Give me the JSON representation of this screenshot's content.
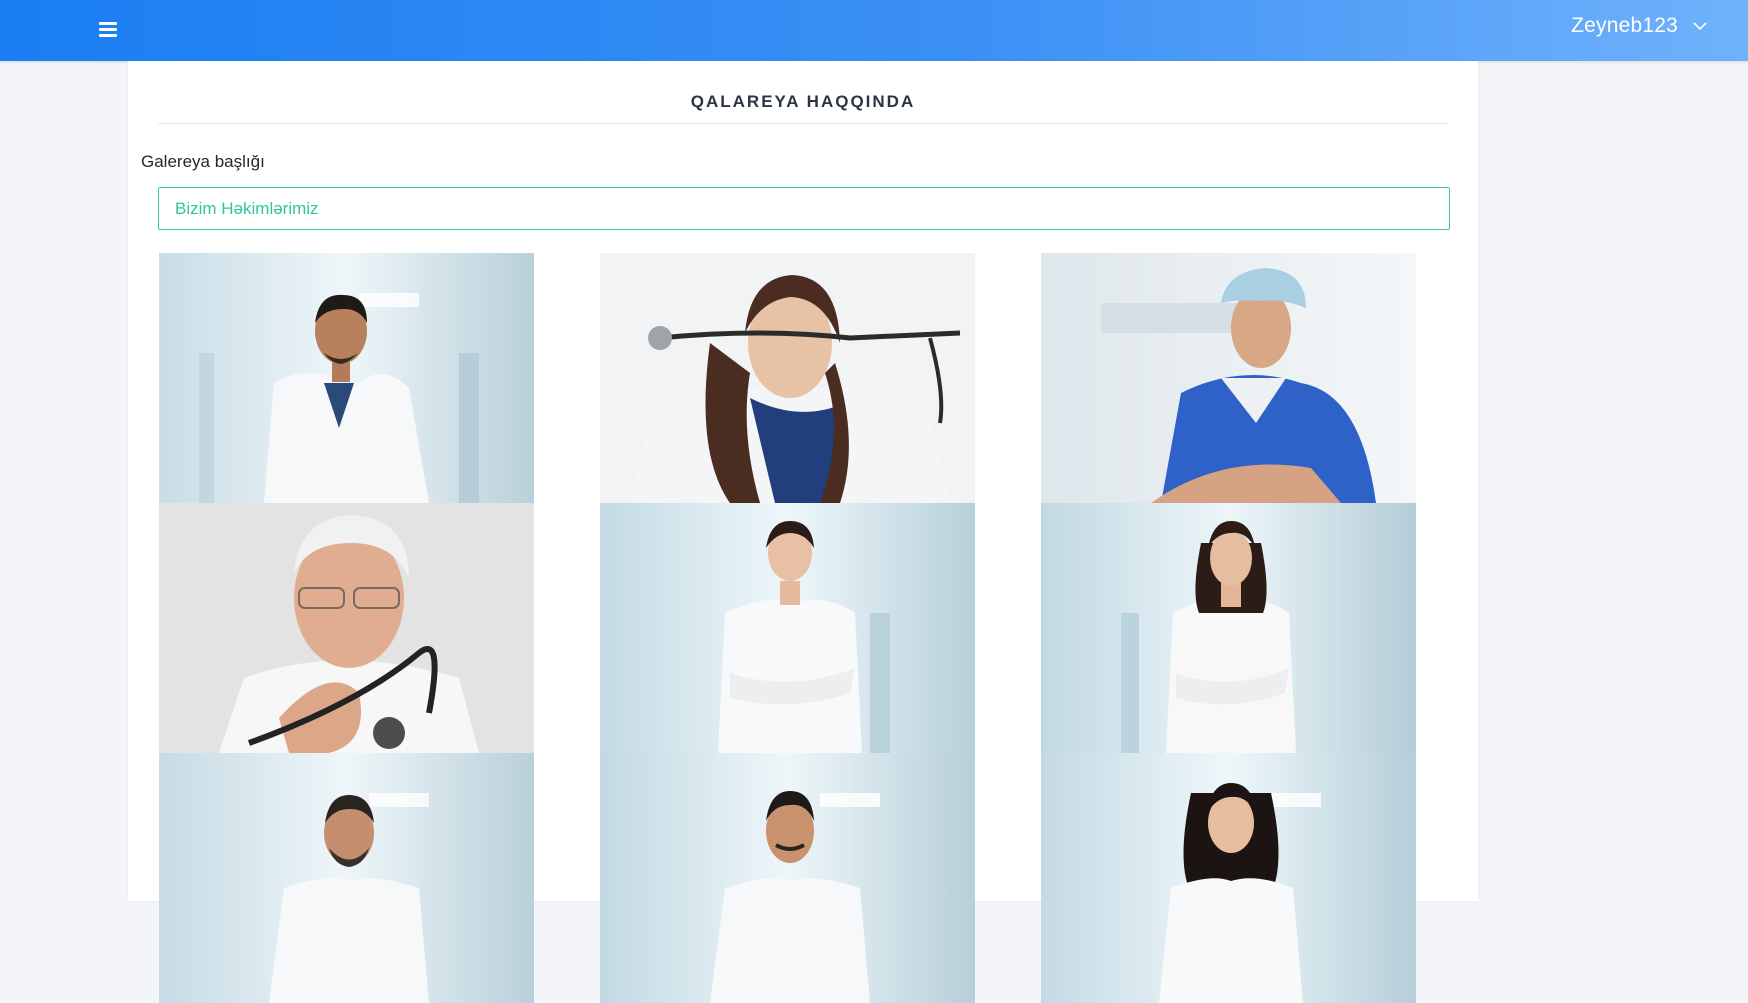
{
  "header": {
    "username": "Zeyneb123",
    "menu_icon": "hamburger-icon",
    "dropdown_icon": "chevron-down-icon"
  },
  "page": {
    "title": "QALAREYA HAQQINDA"
  },
  "form": {
    "gallery_title_label": "Galereya başlığı",
    "gallery_title_value": "Bizim Həkimlərimiz"
  },
  "gallery": {
    "photos": [
      {
        "name": "doctor-photo-1",
        "subject": "male doctor in white coat, hospital corridor"
      },
      {
        "name": "doctor-photo-2",
        "subject": "female doctor holding stethoscope"
      },
      {
        "name": "doctor-photo-3",
        "subject": "surgeon in blue scrubs and cap"
      },
      {
        "name": "doctor-photo-4",
        "subject": "senior doctor with glasses and stethoscope"
      },
      {
        "name": "doctor-photo-5",
        "subject": "female doctor arms crossed, hospital corridor"
      },
      {
        "name": "doctor-photo-6",
        "subject": "female doctor arms crossed, hospital corridor"
      },
      {
        "name": "doctor-photo-7",
        "subject": "male doctor with beard, hospital corridor"
      },
      {
        "name": "doctor-photo-8",
        "subject": "male doctor, hospital corridor"
      },
      {
        "name": "doctor-photo-9",
        "subject": "female doctor, hospital corridor"
      }
    ]
  },
  "colors": {
    "header_start": "#1a7ef2",
    "header_end": "#6fb2fb",
    "input_border": "#3fc7a8",
    "input_text": "#2fc4a2",
    "page_bg": "#f3f5f8"
  }
}
